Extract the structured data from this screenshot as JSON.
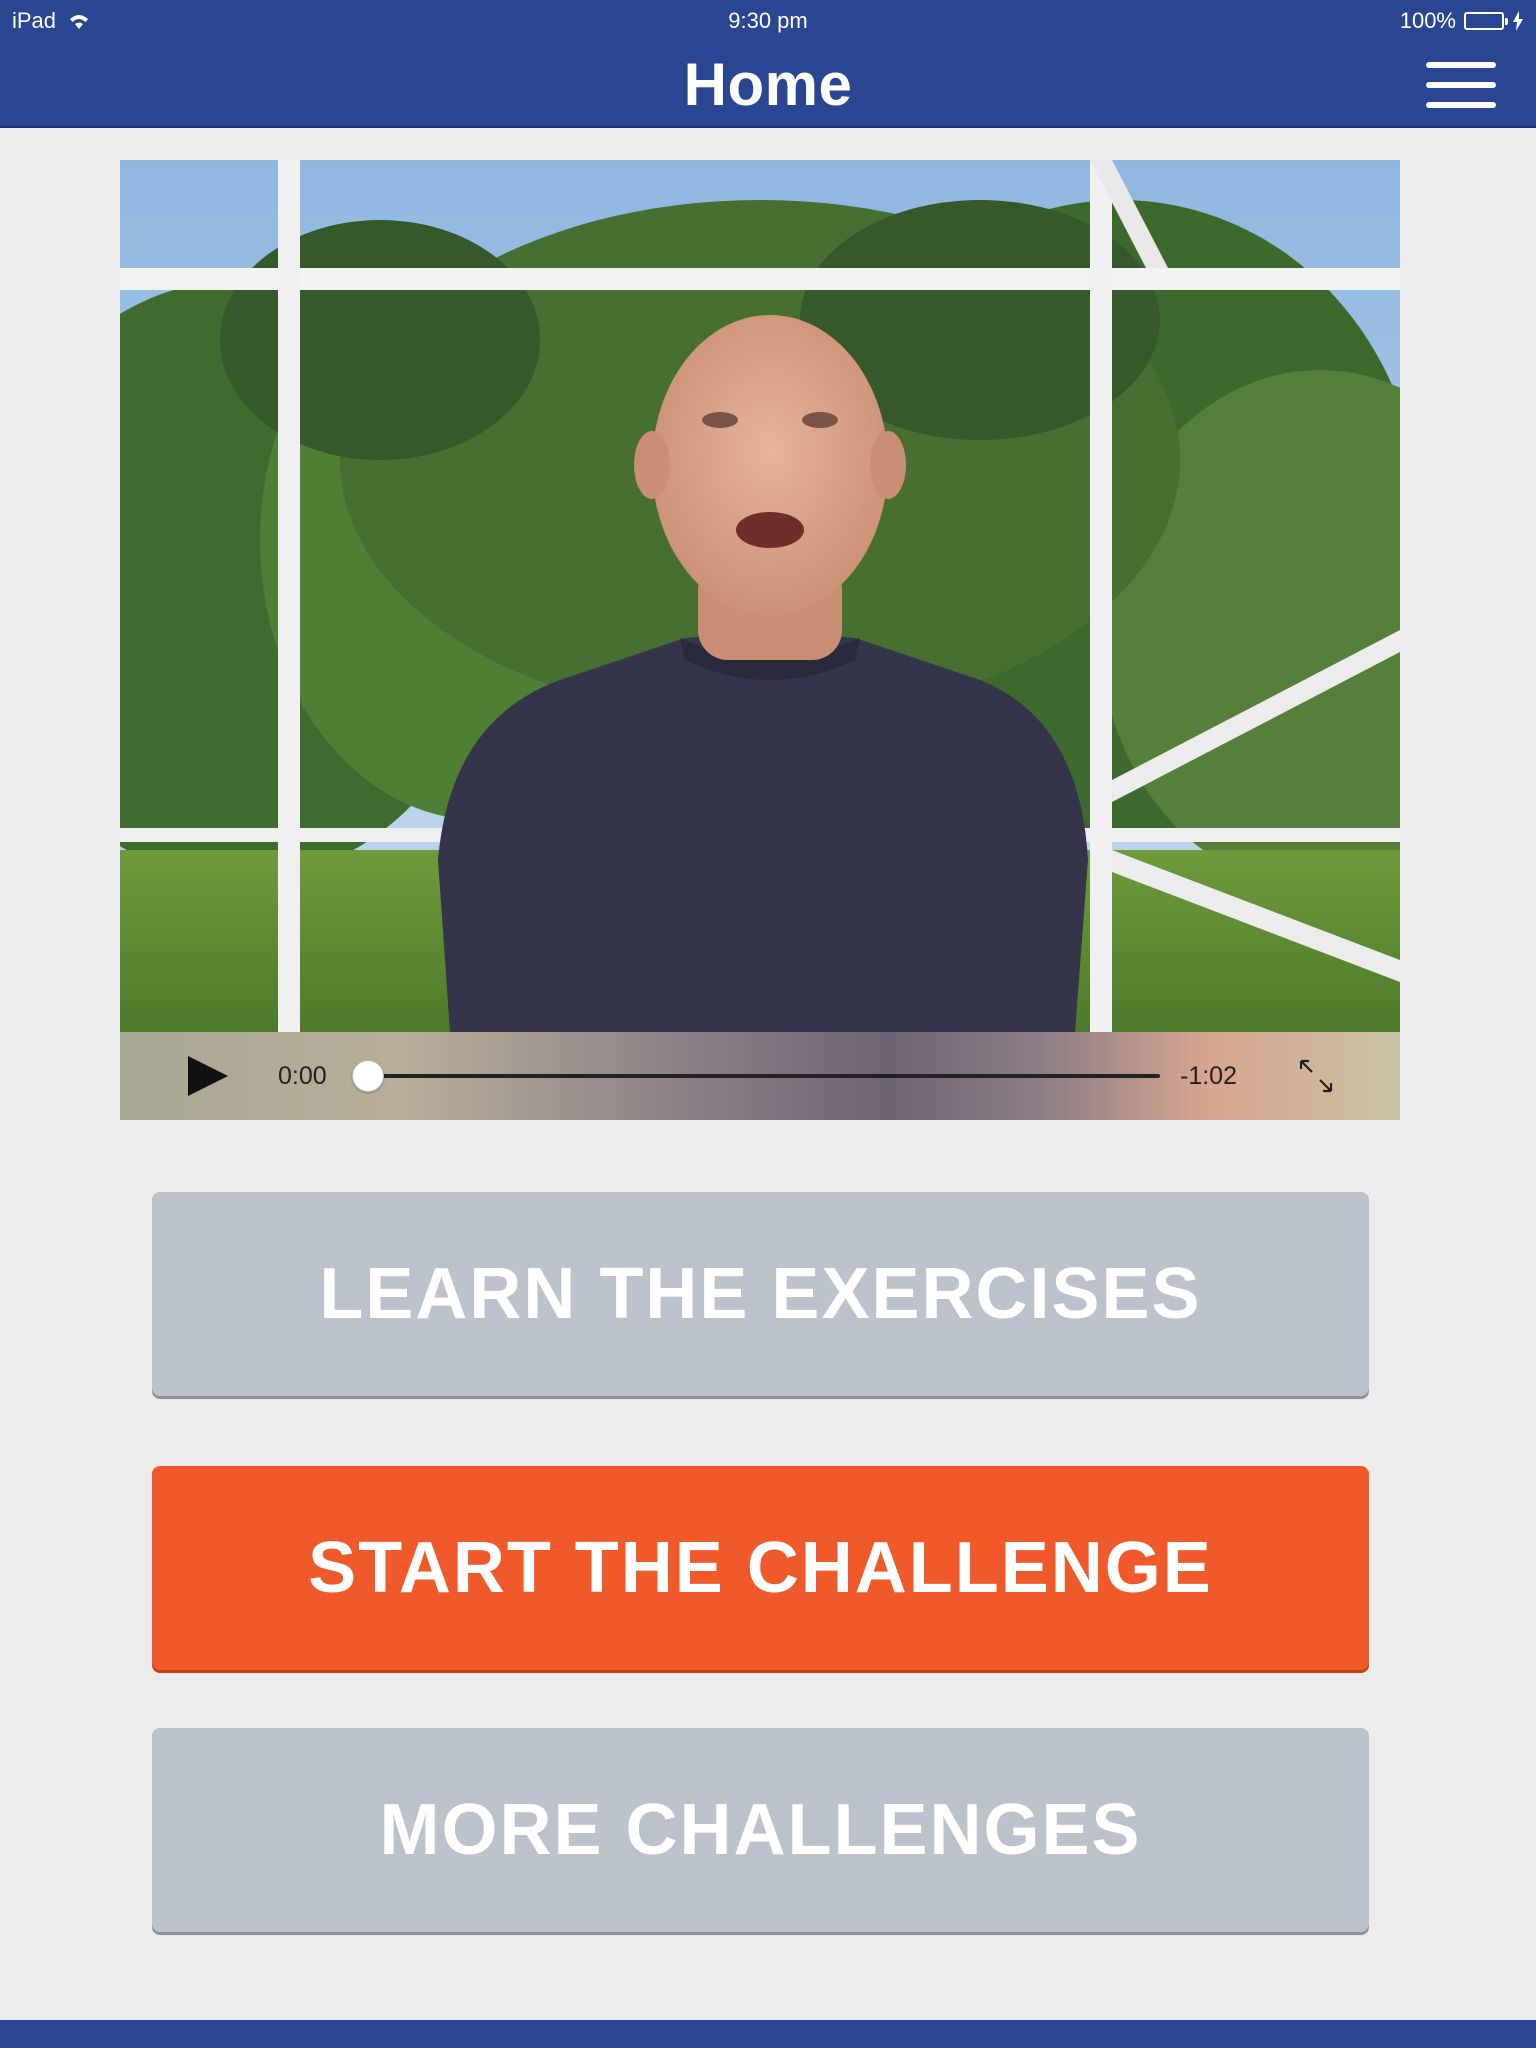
{
  "status_bar": {
    "device": "iPad",
    "time": "9:30 pm",
    "battery": "100%"
  },
  "nav": {
    "title": "Home",
    "menu_icon": "hamburger-menu-icon"
  },
  "video": {
    "current_time": "0:00",
    "remaining_time": "-1:02",
    "progress": 0.0,
    "icons": [
      "play-icon",
      "fullscreen-icon"
    ]
  },
  "buttons": {
    "learn": "LEARN THE EXERCISES",
    "start": "START THE CHALLENGE",
    "more": "MORE CHALLENGES"
  },
  "colors": {
    "brand_blue": "#2a4592",
    "accent_orange": "#f05a2b",
    "button_gray": "#bbc2cb",
    "background": "#ececec"
  }
}
